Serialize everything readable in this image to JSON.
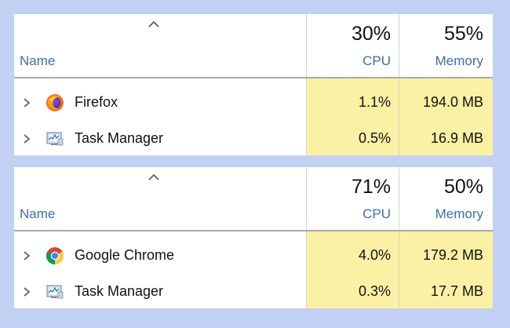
{
  "panels": [
    {
      "header": {
        "name_label": "Name",
        "cpu_label": "CPU",
        "memory_label": "Memory",
        "cpu_total": "30%",
        "memory_total": "55%"
      },
      "rows": [
        {
          "name": "Firefox",
          "icon": "firefox-icon",
          "cpu": "1.1%",
          "memory": "194.0 MB"
        },
        {
          "name": "Task Manager",
          "icon": "task-manager-icon",
          "cpu": "0.5%",
          "memory": "16.9 MB"
        }
      ]
    },
    {
      "header": {
        "name_label": "Name",
        "cpu_label": "CPU",
        "memory_label": "Memory",
        "cpu_total": "71%",
        "memory_total": "50%"
      },
      "rows": [
        {
          "name": "Google Chrome",
          "icon": "chrome-icon",
          "cpu": "4.0%",
          "memory": "179.2 MB"
        },
        {
          "name": "Task Manager",
          "icon": "task-manager-icon",
          "cpu": "0.3%",
          "memory": "17.7 MB"
        }
      ]
    }
  ],
  "colors": {
    "background": "#c2d0f3",
    "heat_cell": "#fbf1a5",
    "header_text": "#3e6fa8"
  }
}
